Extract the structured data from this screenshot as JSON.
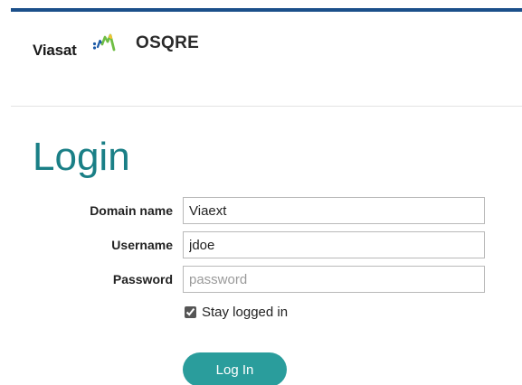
{
  "header": {
    "brand": "Viasat",
    "app_name": "OSQRE"
  },
  "login": {
    "title": "Login",
    "domain": {
      "label": "Domain name",
      "value": "Viaext"
    },
    "username": {
      "label": "Username",
      "value": "jdoe"
    },
    "password": {
      "label": "Password",
      "placeholder": "password"
    },
    "stay_logged_in": {
      "label": "Stay logged in",
      "checked": true
    },
    "submit_label": "Log In"
  },
  "colors": {
    "top_bar": "#1b4f8a",
    "title": "#1a7f86",
    "button": "#2a9d9c",
    "logo_blue": "#1c5aa6",
    "logo_green": "#6fbe44",
    "logo_yellow": "#f2c230"
  }
}
